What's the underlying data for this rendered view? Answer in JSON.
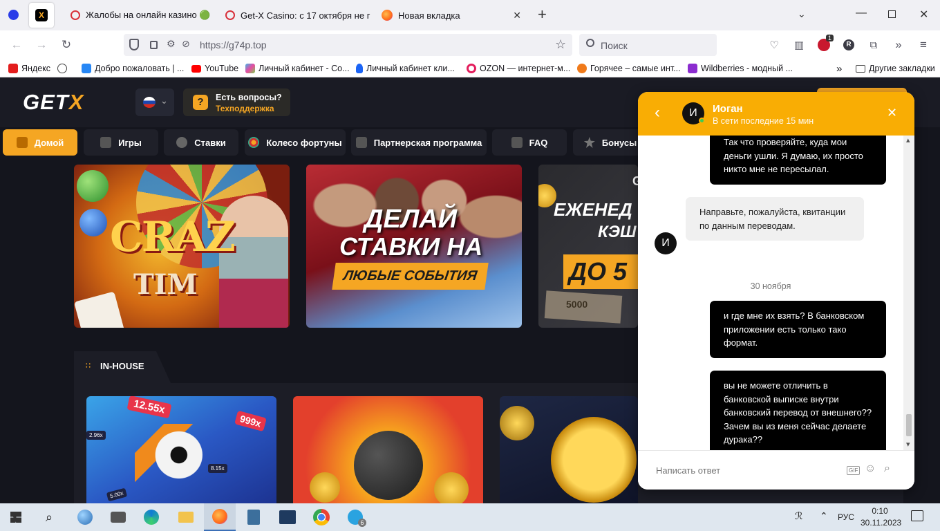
{
  "tabs": [
    {
      "title": ""
    },
    {
      "title": "Жалобы на онлайн казино 🟢"
    },
    {
      "title": "Get-X Casino: с 17 октября не г"
    },
    {
      "title": "Новая вкладка"
    }
  ],
  "toolbar": {
    "new_tab": "+",
    "url": "https://g74p.top",
    "search_placeholder": "Поиск",
    "badge_count": "1",
    "account_letter": "R"
  },
  "bookmarks": [
    {
      "label": "Яндекс",
      "color": "#e31d1d"
    },
    {
      "label": "",
      "color": "#444"
    },
    {
      "label": "Добро пожаловать | ...",
      "color": "#2787f5"
    },
    {
      "label": "YouTube",
      "color": "#ff0000"
    },
    {
      "label": "Личный кабинет - Со...",
      "color": "#3fb5e9"
    },
    {
      "label": "Личный кабинет кли...",
      "color": "#1b64f5"
    },
    {
      "label": "OZON — интернет-м...",
      "color": "#005bff"
    },
    {
      "label": "Горячее – самые инт...",
      "color": "#f07a1a"
    },
    {
      "label": "Wildberries - модный ...",
      "color": "#8b2ccf"
    },
    {
      "label": "Другие закладки",
      "color": "#666"
    }
  ],
  "site": {
    "logo_main": "GET",
    "logo_accent": "X",
    "support_title": "Есть вопросы?",
    "support_sub": "Техподдержка",
    "menu": [
      {
        "label": "Домой",
        "active": true
      },
      {
        "label": "Игры"
      },
      {
        "label": "Ставки"
      },
      {
        "label": "Колесо фортуны"
      },
      {
        "label": "Партнерская программа"
      },
      {
        "label": "FAQ"
      },
      {
        "label": "Бонусы"
      }
    ],
    "banners": [
      {
        "line1": "CRAZ",
        "line2": "TIM"
      },
      {
        "line1": "ДЕЛАЙ",
        "line2": "СТАВКИ НА",
        "badge": "ЛЮБЫЕ СОБЫТИЯ"
      },
      {
        "top": "G",
        "line1": "ЕЖЕНЕД",
        "line2": "КЭШ",
        "line3": "ДО 5",
        "note": "5000"
      }
    ],
    "section_title": "IN-HOUSE",
    "game1": {
      "m1": "12.55x",
      "m2": "999x",
      "m3": "2.96x",
      "m4": "8.15x",
      "m5": "5.00x"
    }
  },
  "chat": {
    "avatar_letter": "И",
    "name": "Иоган",
    "status": "В сети последние 15 мин",
    "messages": [
      {
        "dir": "out",
        "text": "Так что проверяйте, куда мои деньги ушли. Я думаю, их просто никто мне не пересылал."
      },
      {
        "dir": "in",
        "text": "Направьте, пожалуйста, квитанции по данным переводам."
      },
      {
        "dir": "out",
        "text": "и где мне их взять? В банковском приложении есть только тако формат."
      },
      {
        "dir": "out",
        "text": "вы не можете отличить в банковской выписке внутри банковский перевод от внешнего?? Зачем вы из меня сейчас делаете дурака??"
      }
    ],
    "date_label": "30 ноября",
    "input_placeholder": "Написать ответ",
    "gif_label": "GIF"
  },
  "taskbar": {
    "lang": "РУС",
    "time": "0:10",
    "date": "30.11.2023",
    "telegram_badge": "6"
  }
}
